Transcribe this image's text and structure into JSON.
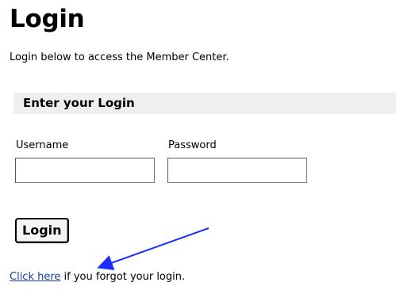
{
  "page": {
    "title": "Login",
    "intro": "Login below to access the Member Center."
  },
  "form": {
    "section_title": "Enter your Login",
    "username_label": "Username",
    "username_value": "",
    "password_label": "Password",
    "password_value": "",
    "submit_label": "Login"
  },
  "forgot": {
    "link_text": "Click here",
    "rest_text": " if you forgot your login."
  },
  "annotation": {
    "arrow_color": "#1a2cff",
    "arrow_icon": "arrow-pointing-to-link"
  },
  "colors": {
    "section_bar": "#efefef",
    "link": "#1a3c9e"
  }
}
